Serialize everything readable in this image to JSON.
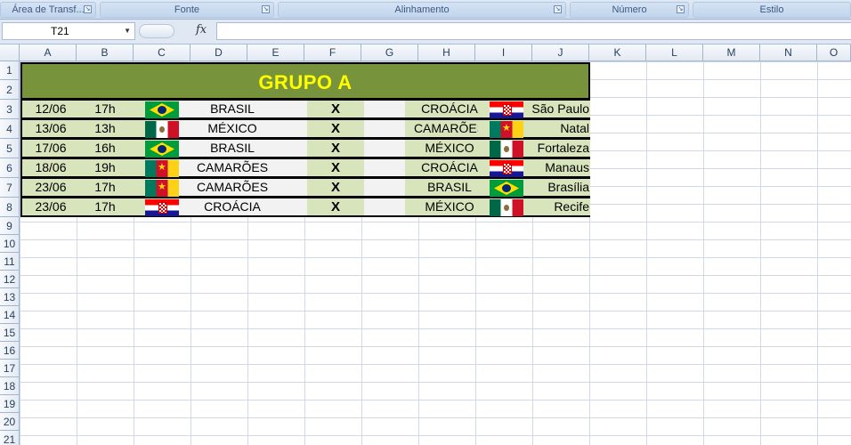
{
  "ribbon": {
    "groups": [
      {
        "label": "Área de Transf..."
      },
      {
        "label": "Fonte"
      },
      {
        "label": "Alinhamento"
      },
      {
        "label": "Número"
      },
      {
        "label": "Estilo"
      }
    ],
    "launcher_icon": "dialog-launcher-icon"
  },
  "formula_bar": {
    "name_box": "T21",
    "fx_label": "fx",
    "formula": ""
  },
  "columns": [
    "A",
    "B",
    "C",
    "D",
    "E",
    "F",
    "G",
    "H",
    "I",
    "J",
    "K",
    "L",
    "M",
    "N",
    "O"
  ],
  "rows": [
    "1",
    "2",
    "3",
    "4",
    "5",
    "6",
    "7",
    "8",
    "9",
    "10",
    "11",
    "12",
    "13",
    "14",
    "15",
    "16",
    "17",
    "18",
    "19",
    "20",
    "21"
  ],
  "table": {
    "title": "GRUPO A",
    "header_color": "#77933c",
    "title_color": "#ffff00",
    "separator": "X",
    "matches": [
      {
        "date": "12/06",
        "time": "17h",
        "team1": "BRASIL",
        "flag1": "brazil-flag-icon",
        "team2": "CROÁCIA",
        "flag2": "croatia-flag-icon",
        "city": "São Paulo"
      },
      {
        "date": "13/06",
        "time": "13h",
        "team1": "MÉXICO",
        "flag1": "mexico-flag-icon",
        "team2": "CAMARÕES",
        "flag2": "cameroon-flag-icon",
        "city": "Natal"
      },
      {
        "date": "17/06",
        "time": "16h",
        "team1": "BRASIL",
        "flag1": "brazil-flag-icon",
        "team2": "MÉXICO",
        "flag2": "mexico-flag-icon",
        "city": "Fortaleza"
      },
      {
        "date": "18/06",
        "time": "19h",
        "team1": "CAMARÕES",
        "flag1": "cameroon-flag-icon",
        "team2": "CROÁCIA",
        "flag2": "croatia-flag-icon",
        "city": "Manaus"
      },
      {
        "date": "23/06",
        "time": "17h",
        "team1": "CAMARÕES",
        "flag1": "cameroon-flag-icon",
        "team2": "BRASIL",
        "flag2": "brazil-flag-icon",
        "city": "Brasília"
      },
      {
        "date": "23/06",
        "time": "17h",
        "team1": "CROÁCIA",
        "flag1": "croatia-flag-icon",
        "team2": "MÉXICO",
        "flag2": "mexico-flag-icon",
        "city": "Recife"
      }
    ]
  }
}
